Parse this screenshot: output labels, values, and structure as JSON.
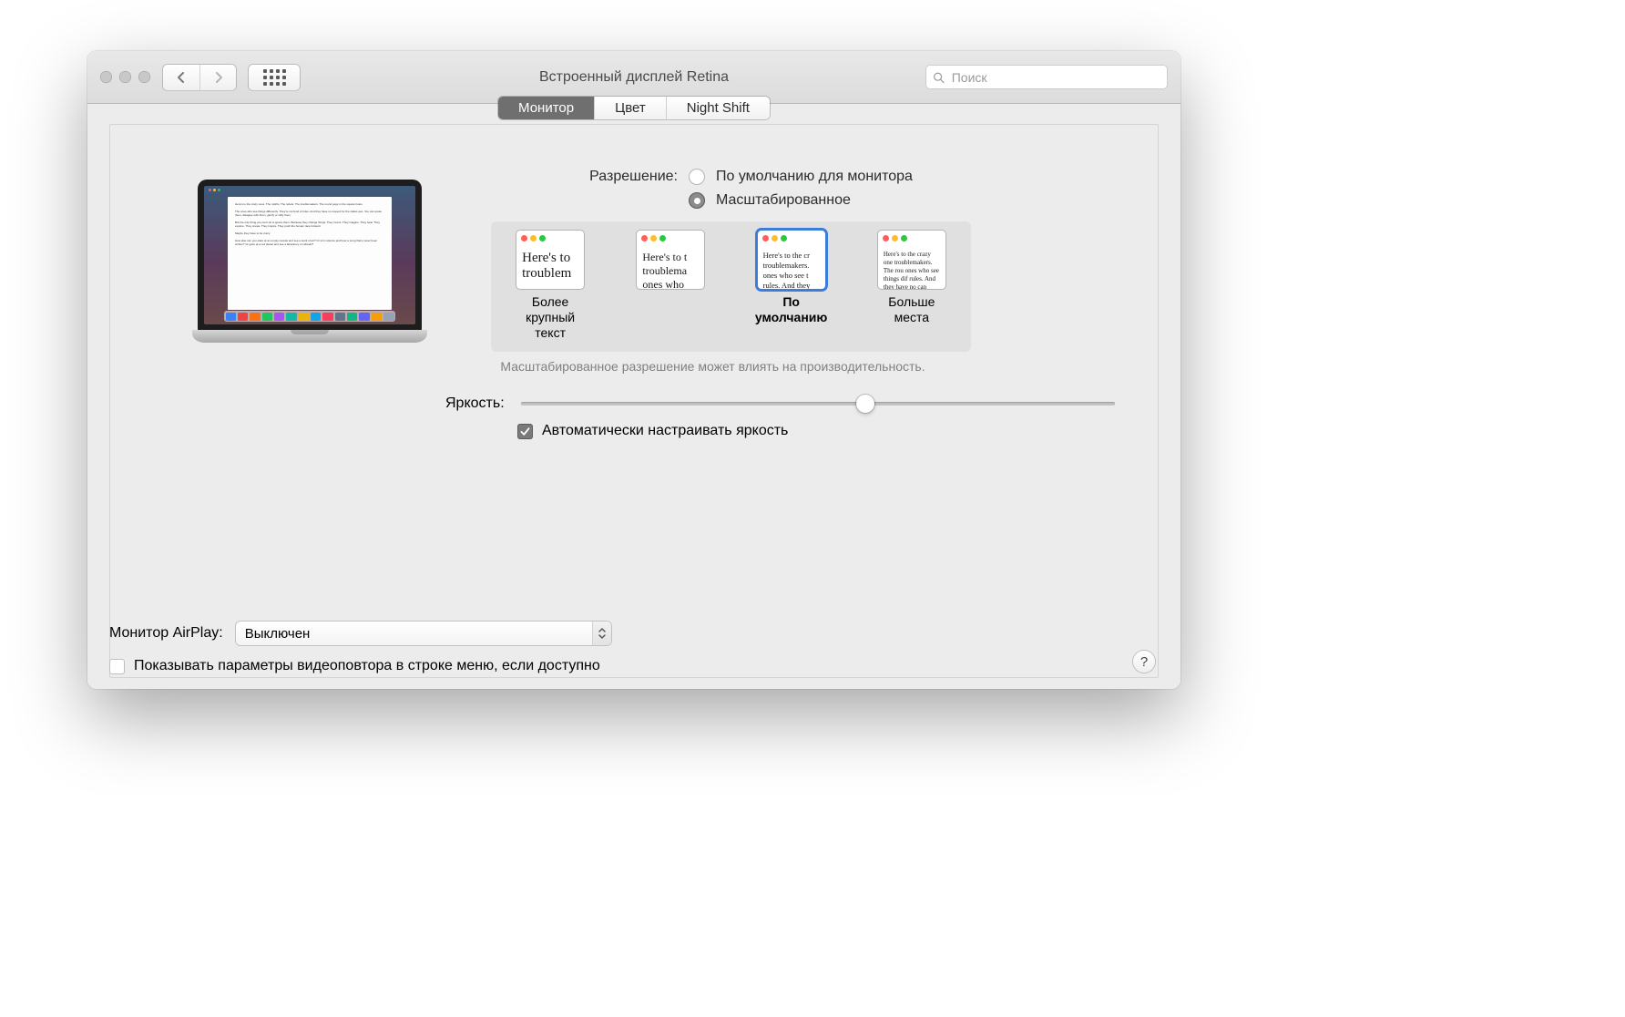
{
  "window": {
    "title": "Встроенный дисплей Retina"
  },
  "search": {
    "placeholder": "Поиск"
  },
  "tabs": {
    "monitor": "Монитор",
    "color": "Цвет",
    "nightshift": "Night Shift"
  },
  "resolution": {
    "label": "Разрешение:",
    "option_default": "По умолчанию для монитора",
    "option_scaled": "Масштабированное"
  },
  "thumbs": {
    "sample1": "Here's to troublem",
    "sample2": "Here's to t troublema ones who",
    "sample3": "Here's to the cr troublemakers. ones who see t rules. And they",
    "sample4": "Here's to the crazy one troublemakers. The rou ones who see things dif rules. And they have no can quote them, disagr them. About the only th Because they change t",
    "cap_larger": "Более крупный текст",
    "cap_default": "По умолчанию",
    "cap_more": "Больше места"
  },
  "warning": "Масштабированное разрешение может влиять на производительность.",
  "brightness": {
    "label": "Яркость:"
  },
  "auto_brightness": {
    "label": "Автоматически настраивать яркость"
  },
  "airplay": {
    "label": "Монитор AirPlay:",
    "value": "Выключен"
  },
  "mirror": {
    "label": "Показывать параметры видеоповтора в строке меню, если доступно"
  },
  "help": {
    "symbol": "?"
  }
}
